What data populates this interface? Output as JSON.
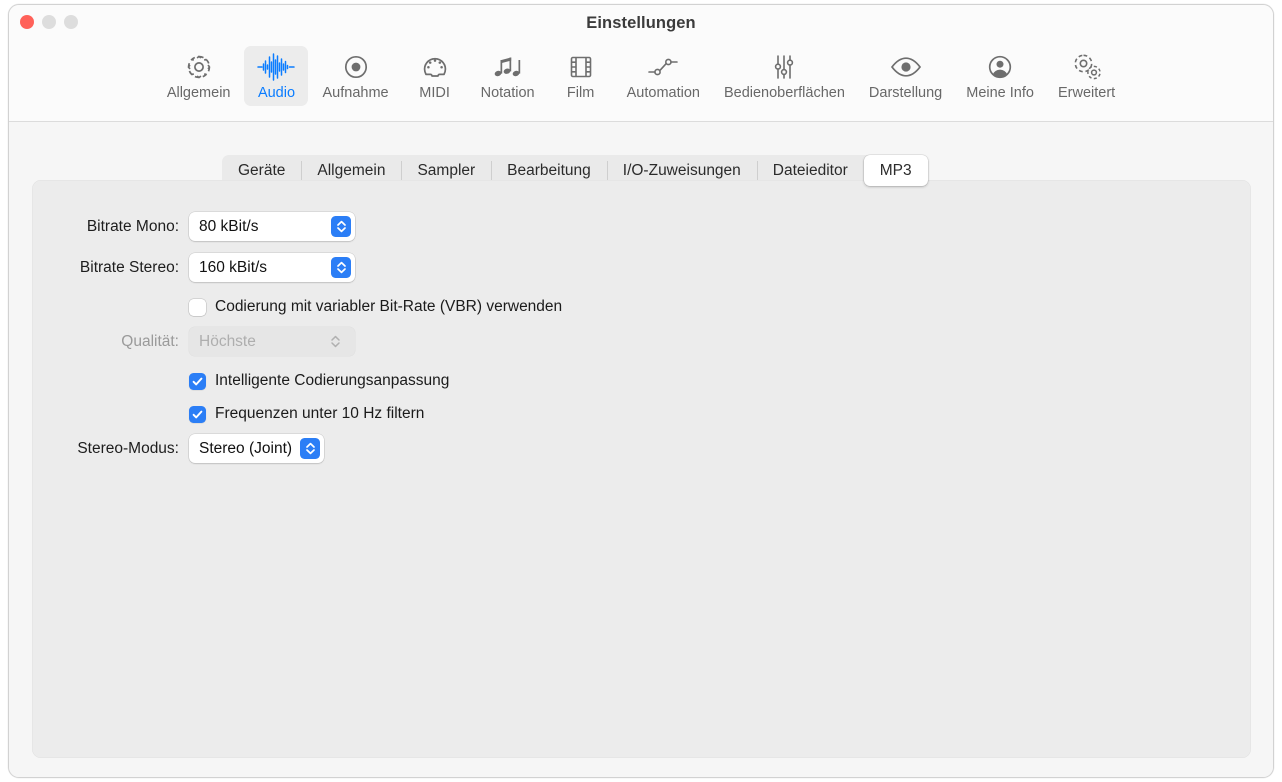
{
  "window": {
    "title": "Einstellungen",
    "traffic_lights": [
      "close",
      "minimize",
      "maximize"
    ]
  },
  "toolbar": {
    "items": [
      {
        "label": "Allgemein",
        "icon": "gear-icon",
        "selected": false
      },
      {
        "label": "Audio",
        "icon": "waveform-icon",
        "selected": true
      },
      {
        "label": "Aufnahme",
        "icon": "record-icon",
        "selected": false
      },
      {
        "label": "MIDI",
        "icon": "midi-port-icon",
        "selected": false
      },
      {
        "label": "Notation",
        "icon": "music-notes-icon",
        "selected": false
      },
      {
        "label": "Film",
        "icon": "film-strip-icon",
        "selected": false
      },
      {
        "label": "Automation",
        "icon": "automation-icon",
        "selected": false
      },
      {
        "label": "Bedienoberflächen",
        "icon": "faders-icon",
        "selected": false
      },
      {
        "label": "Darstellung",
        "icon": "eye-icon",
        "selected": false
      },
      {
        "label": "Meine Info",
        "icon": "person-icon",
        "selected": false
      },
      {
        "label": "Erweitert",
        "icon": "double-gear-icon",
        "selected": false
      }
    ]
  },
  "tabs": {
    "items": [
      {
        "label": "Geräte",
        "selected": false
      },
      {
        "label": "Allgemein",
        "selected": false
      },
      {
        "label": "Sampler",
        "selected": false
      },
      {
        "label": "Bearbeitung",
        "selected": false
      },
      {
        "label": "I/O-Zuweisungen",
        "selected": false
      },
      {
        "label": "Dateieditor",
        "selected": false
      },
      {
        "label": "MP3",
        "selected": true
      }
    ]
  },
  "form": {
    "bitrate_mono": {
      "label": "Bitrate Mono:",
      "value": "80 kBit/s",
      "enabled": true
    },
    "bitrate_stereo": {
      "label": "Bitrate Stereo:",
      "value": "160 kBit/s",
      "enabled": true
    },
    "vbr": {
      "label": "Codierung mit variabler Bit-Rate (VBR) verwenden",
      "checked": false
    },
    "quality": {
      "label": "Qualität:",
      "value": "Höchste",
      "enabled": false
    },
    "smart_encoding": {
      "label": "Intelligente Codierungsanpassung",
      "checked": true
    },
    "filter_low": {
      "label": "Frequenzen unter 10 Hz filtern",
      "checked": true
    },
    "stereo_mode": {
      "label": "Stereo-Modus:",
      "value": "Stereo (Joint)",
      "enabled": true
    }
  },
  "colors": {
    "accent": "#2b7ef6",
    "selected_tab_text": "#0a7cff",
    "close_button": "#ff6159",
    "window_bg": "#f6f6f6",
    "panel_bg": "#ececec"
  }
}
